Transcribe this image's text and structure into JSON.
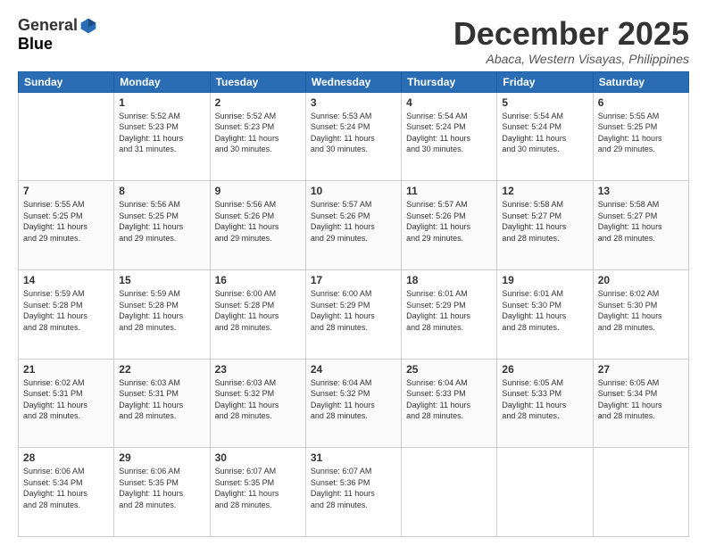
{
  "logo": {
    "general": "General",
    "blue": "Blue"
  },
  "title": "December 2025",
  "subtitle": "Abaca, Western Visayas, Philippines",
  "days_header": [
    "Sunday",
    "Monday",
    "Tuesday",
    "Wednesday",
    "Thursday",
    "Friday",
    "Saturday"
  ],
  "weeks": [
    [
      {
        "num": "",
        "info": ""
      },
      {
        "num": "1",
        "info": "Sunrise: 5:52 AM\nSunset: 5:23 PM\nDaylight: 11 hours\nand 31 minutes."
      },
      {
        "num": "2",
        "info": "Sunrise: 5:52 AM\nSunset: 5:23 PM\nDaylight: 11 hours\nand 30 minutes."
      },
      {
        "num": "3",
        "info": "Sunrise: 5:53 AM\nSunset: 5:24 PM\nDaylight: 11 hours\nand 30 minutes."
      },
      {
        "num": "4",
        "info": "Sunrise: 5:54 AM\nSunset: 5:24 PM\nDaylight: 11 hours\nand 30 minutes."
      },
      {
        "num": "5",
        "info": "Sunrise: 5:54 AM\nSunset: 5:24 PM\nDaylight: 11 hours\nand 30 minutes."
      },
      {
        "num": "6",
        "info": "Sunrise: 5:55 AM\nSunset: 5:25 PM\nDaylight: 11 hours\nand 29 minutes."
      }
    ],
    [
      {
        "num": "7",
        "info": "Sunrise: 5:55 AM\nSunset: 5:25 PM\nDaylight: 11 hours\nand 29 minutes."
      },
      {
        "num": "8",
        "info": "Sunrise: 5:56 AM\nSunset: 5:25 PM\nDaylight: 11 hours\nand 29 minutes."
      },
      {
        "num": "9",
        "info": "Sunrise: 5:56 AM\nSunset: 5:26 PM\nDaylight: 11 hours\nand 29 minutes."
      },
      {
        "num": "10",
        "info": "Sunrise: 5:57 AM\nSunset: 5:26 PM\nDaylight: 11 hours\nand 29 minutes."
      },
      {
        "num": "11",
        "info": "Sunrise: 5:57 AM\nSunset: 5:26 PM\nDaylight: 11 hours\nand 29 minutes."
      },
      {
        "num": "12",
        "info": "Sunrise: 5:58 AM\nSunset: 5:27 PM\nDaylight: 11 hours\nand 28 minutes."
      },
      {
        "num": "13",
        "info": "Sunrise: 5:58 AM\nSunset: 5:27 PM\nDaylight: 11 hours\nand 28 minutes."
      }
    ],
    [
      {
        "num": "14",
        "info": "Sunrise: 5:59 AM\nSunset: 5:28 PM\nDaylight: 11 hours\nand 28 minutes."
      },
      {
        "num": "15",
        "info": "Sunrise: 5:59 AM\nSunset: 5:28 PM\nDaylight: 11 hours\nand 28 minutes."
      },
      {
        "num": "16",
        "info": "Sunrise: 6:00 AM\nSunset: 5:28 PM\nDaylight: 11 hours\nand 28 minutes."
      },
      {
        "num": "17",
        "info": "Sunrise: 6:00 AM\nSunset: 5:29 PM\nDaylight: 11 hours\nand 28 minutes."
      },
      {
        "num": "18",
        "info": "Sunrise: 6:01 AM\nSunset: 5:29 PM\nDaylight: 11 hours\nand 28 minutes."
      },
      {
        "num": "19",
        "info": "Sunrise: 6:01 AM\nSunset: 5:30 PM\nDaylight: 11 hours\nand 28 minutes."
      },
      {
        "num": "20",
        "info": "Sunrise: 6:02 AM\nSunset: 5:30 PM\nDaylight: 11 hours\nand 28 minutes."
      }
    ],
    [
      {
        "num": "21",
        "info": "Sunrise: 6:02 AM\nSunset: 5:31 PM\nDaylight: 11 hours\nand 28 minutes."
      },
      {
        "num": "22",
        "info": "Sunrise: 6:03 AM\nSunset: 5:31 PM\nDaylight: 11 hours\nand 28 minutes."
      },
      {
        "num": "23",
        "info": "Sunrise: 6:03 AM\nSunset: 5:32 PM\nDaylight: 11 hours\nand 28 minutes."
      },
      {
        "num": "24",
        "info": "Sunrise: 6:04 AM\nSunset: 5:32 PM\nDaylight: 11 hours\nand 28 minutes."
      },
      {
        "num": "25",
        "info": "Sunrise: 6:04 AM\nSunset: 5:33 PM\nDaylight: 11 hours\nand 28 minutes."
      },
      {
        "num": "26",
        "info": "Sunrise: 6:05 AM\nSunset: 5:33 PM\nDaylight: 11 hours\nand 28 minutes."
      },
      {
        "num": "27",
        "info": "Sunrise: 6:05 AM\nSunset: 5:34 PM\nDaylight: 11 hours\nand 28 minutes."
      }
    ],
    [
      {
        "num": "28",
        "info": "Sunrise: 6:06 AM\nSunset: 5:34 PM\nDaylight: 11 hours\nand 28 minutes."
      },
      {
        "num": "29",
        "info": "Sunrise: 6:06 AM\nSunset: 5:35 PM\nDaylight: 11 hours\nand 28 minutes."
      },
      {
        "num": "30",
        "info": "Sunrise: 6:07 AM\nSunset: 5:35 PM\nDaylight: 11 hours\nand 28 minutes."
      },
      {
        "num": "31",
        "info": "Sunrise: 6:07 AM\nSunset: 5:36 PM\nDaylight: 11 hours\nand 28 minutes."
      },
      {
        "num": "",
        "info": ""
      },
      {
        "num": "",
        "info": ""
      },
      {
        "num": "",
        "info": ""
      }
    ]
  ]
}
